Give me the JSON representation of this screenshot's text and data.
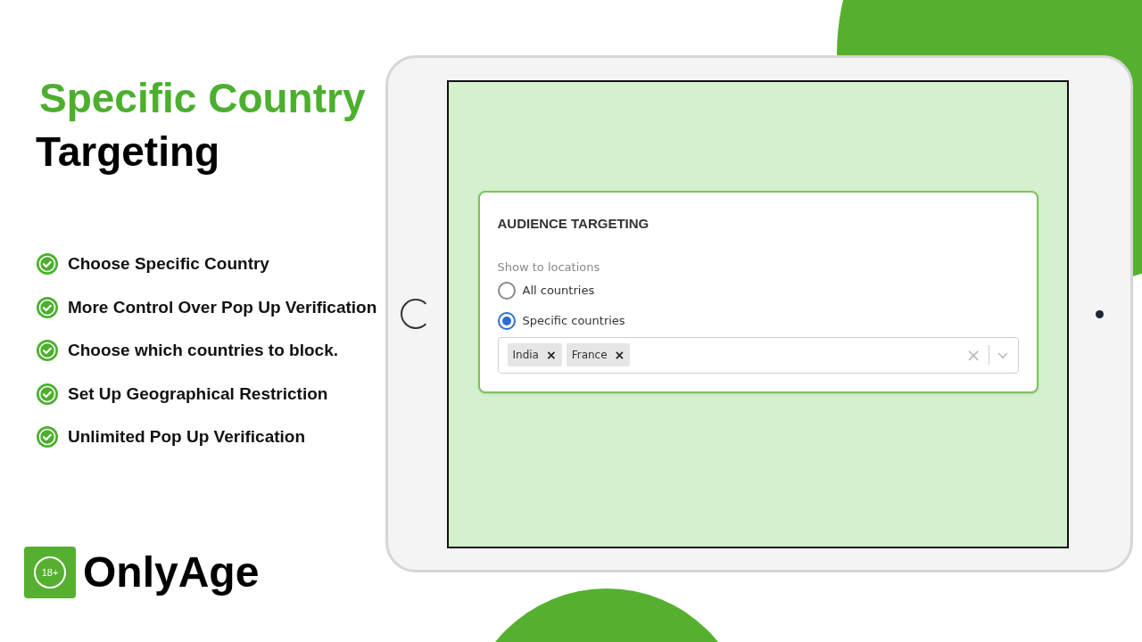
{
  "headline": {
    "line_1": "Specific Country",
    "line_2": "Targeting"
  },
  "features": [
    "Choose Specific Country",
    "More Control Over Pop Up Verification",
    "Choose which countries to block.",
    "Set Up Geographical Restriction",
    "Unlimited Pop Up Verification"
  ],
  "logo": {
    "badge": "18+",
    "name": "OnlyAge"
  },
  "panel": {
    "title": "AUDIENCE TARGETING",
    "label": "Show to locations",
    "options": [
      {
        "label": "All countries",
        "selected": false
      },
      {
        "label": "Specific countries",
        "selected": true
      }
    ],
    "tags": [
      "India",
      "France"
    ],
    "tag_remove": "×",
    "clear": "×"
  }
}
